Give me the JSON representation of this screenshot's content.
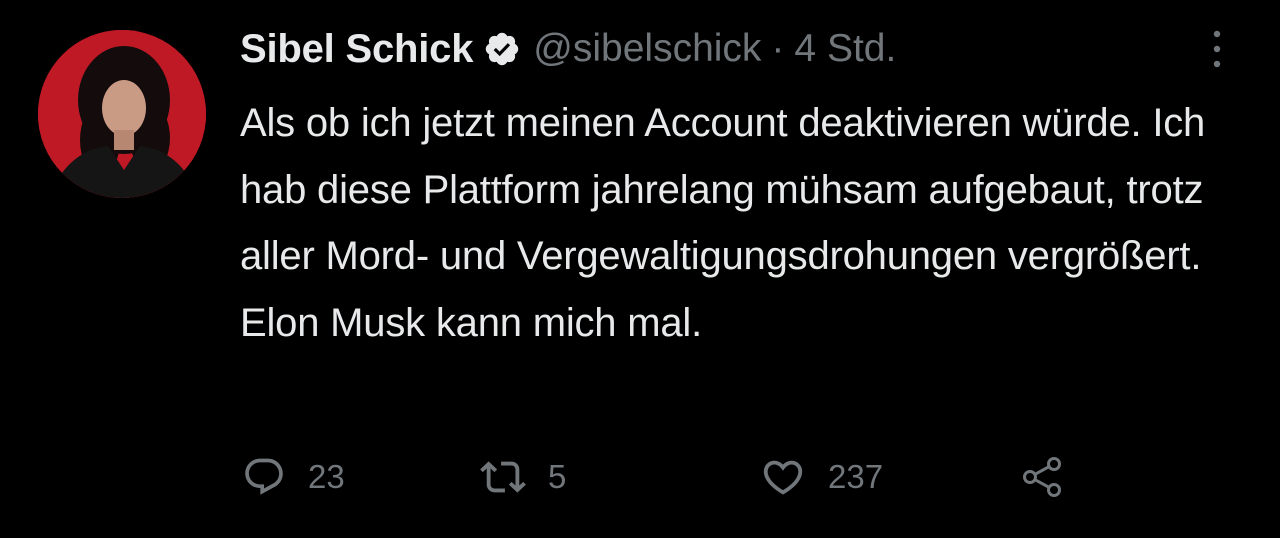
{
  "tweet": {
    "author": {
      "display_name": "Sibel Schick",
      "handle": "@sibelschick",
      "verified": true
    },
    "separator": "·",
    "timestamp": "4 Std.",
    "text": "Als ob ich jetzt meinen Account deaktivieren würde. Ich hab diese Plattform jahrelang mühsam aufgebaut, trotz aller Mord- und Vergewaltigungsdrohungen vergrößert. Elon Musk kann mich mal.",
    "actions": {
      "reply_count": "23",
      "retweet_count": "5",
      "like_count": "237"
    }
  },
  "colors": {
    "background": "#000000",
    "text_primary": "#e7e9ea",
    "text_secondary": "#71767b",
    "avatar_background": "#c81d2a"
  },
  "icons": {
    "verified": "verified-badge-icon",
    "more": "more-vertical-icon",
    "reply": "reply-icon",
    "retweet": "retweet-icon",
    "like": "heart-icon",
    "share": "share-icon"
  }
}
